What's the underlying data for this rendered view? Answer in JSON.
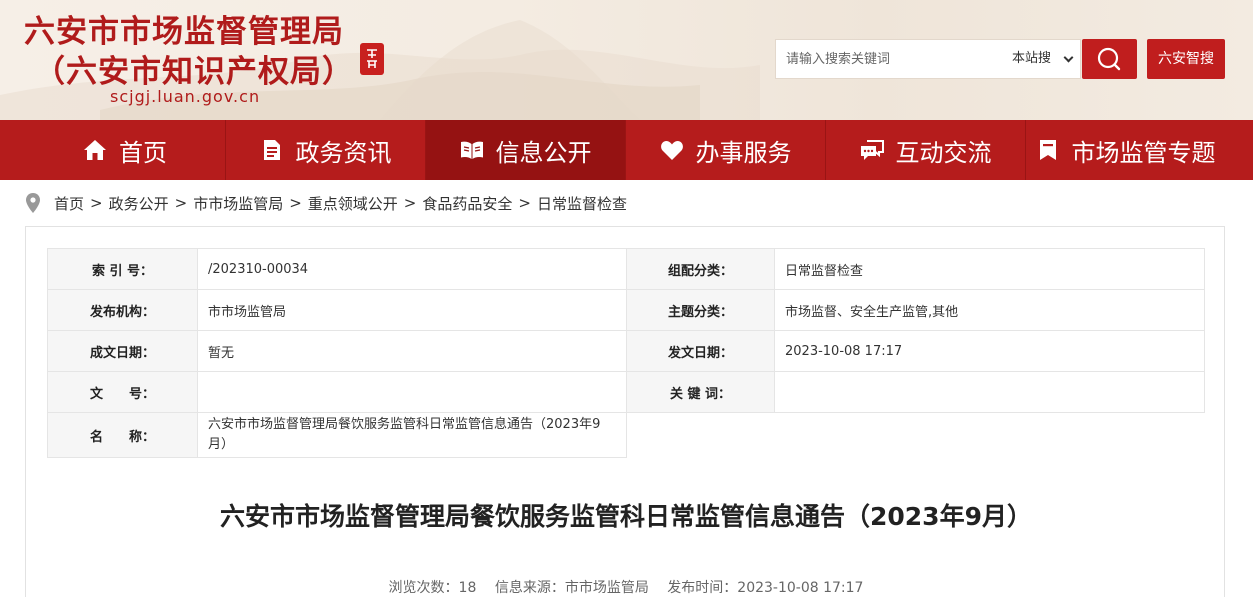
{
  "header": {
    "title_line1": "六安市市场监督管理局",
    "title_line2": "（六安市知识产权局）",
    "domain": "scjgj.luan.gov.cn",
    "seal_text": "六安市人民",
    "search": {
      "placeholder": "请输入搜索关键词",
      "value": "",
      "scope": "本站搜"
    },
    "smart_search_label": "六安智搜"
  },
  "nav": {
    "items": [
      {
        "label": "首页",
        "icon": "home-icon"
      },
      {
        "label": "政务资讯",
        "icon": "document-icon"
      },
      {
        "label": "信息公开",
        "icon": "open-book-icon"
      },
      {
        "label": "办事服务",
        "icon": "heart-icon"
      },
      {
        "label": "互动交流",
        "icon": "chat-icon"
      },
      {
        "label": "市场监管专题",
        "icon": "bookmark-icon"
      }
    ],
    "active_index": 2
  },
  "breadcrumb": [
    "首页",
    "政务公开",
    "市市场监管局",
    "重点领域公开",
    "食品药品安全",
    "日常监督检查"
  ],
  "meta": {
    "index_label": "索 引 号：",
    "index_value": "/202310-00034",
    "category_label": "组配分类：",
    "category_value": "日常监督检查",
    "publisher_label": "发布机构：",
    "publisher_value": "市市场监管局",
    "topic_label": "主题分类：",
    "topic_value": "市场监督、安全生产监管,其他",
    "created_label": "成文日期：",
    "created_value": "暂无",
    "published_label": "发文日期：",
    "published_value": "2023-10-08 17:17",
    "docno_label": "文　　号：",
    "docno_value": "",
    "keywords_label": "关 键 词：",
    "keywords_value": "",
    "name_label": "名　　称：",
    "name_value": "六安市市场监督管理局餐饮服务监管科日常监管信息通告（2023年9月）"
  },
  "article": {
    "title": "六安市市场监督管理局餐饮服务监管科日常监管信息通告（2023年9月）",
    "views": "浏览次数：18",
    "source": "信息来源：市市场监管局",
    "time": "发布时间：2023-10-08 17:17"
  },
  "colors": {
    "brand_red": "#b51c1c",
    "nav_active": "#951212",
    "button_red": "#c01e1e"
  }
}
